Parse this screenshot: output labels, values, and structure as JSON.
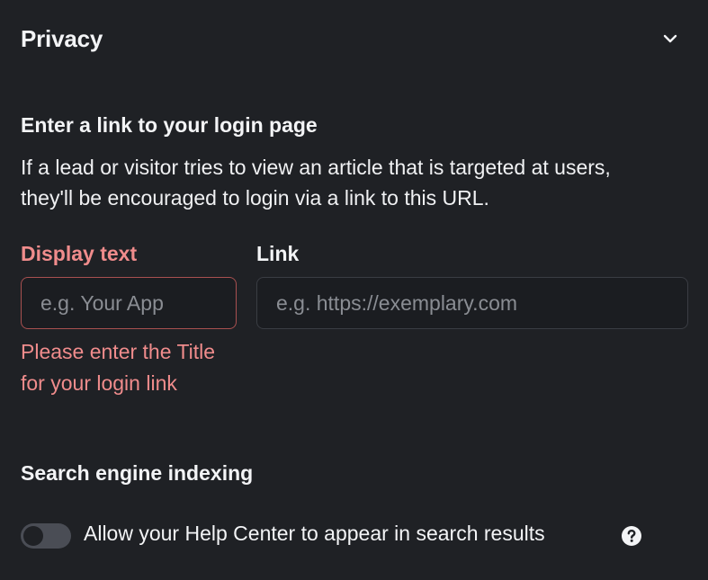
{
  "section": {
    "title": "Privacy",
    "collapse_icon": "chevron-down-icon"
  },
  "login": {
    "heading": "Enter a link to your login page",
    "description": "If a lead or visitor tries to view an article that is targeted at users, they'll be encouraged to login via a link to this URL.",
    "display_text_label": "Display text",
    "display_text_placeholder": "e.g. Your App",
    "display_text_value": "",
    "link_label": "Link",
    "link_placeholder": "e.g. https://exemplary.com",
    "link_value": "",
    "error": "Please enter the Title for your login link"
  },
  "search_indexing": {
    "heading": "Search engine indexing",
    "toggle_label": "Allow your Help Center to appear in search results",
    "toggle_on": false,
    "help_icon": "question-circle-icon"
  },
  "colors": {
    "background": "#1f2125",
    "error": "#f08c8c",
    "error_border": "#a85050",
    "toggle_track": "#4a4d55"
  }
}
